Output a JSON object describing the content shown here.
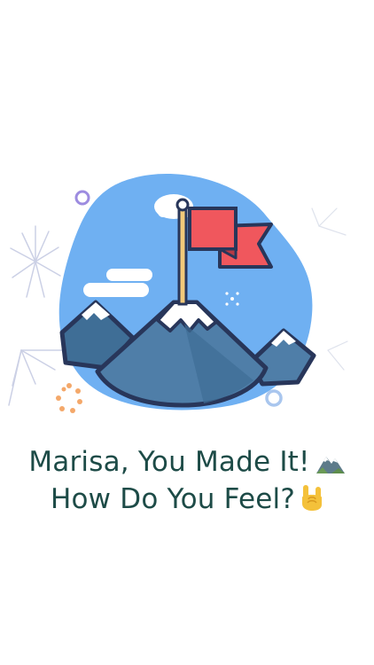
{
  "screen": {
    "headline_line1": "Marisa, You Made It!",
    "headline_line2": "How Do You Feel?",
    "emoji_line1": "mountain-emoji",
    "emoji_line2": "rock-on-hand-emoji"
  },
  "colors": {
    "headline": "#1d4b47",
    "sky_blob": "#6fb0f2",
    "mountain_dark": "#3f6e96",
    "mountain_mid": "#4f7ea8",
    "outline": "#28365a",
    "flag_red": "#f0575d",
    "flag_pole": "#f2c97a",
    "snow": "#ffffff"
  },
  "icons": {
    "illustration": "summit-flag-illustration",
    "sparkles": "sparkle-burst-icon"
  }
}
